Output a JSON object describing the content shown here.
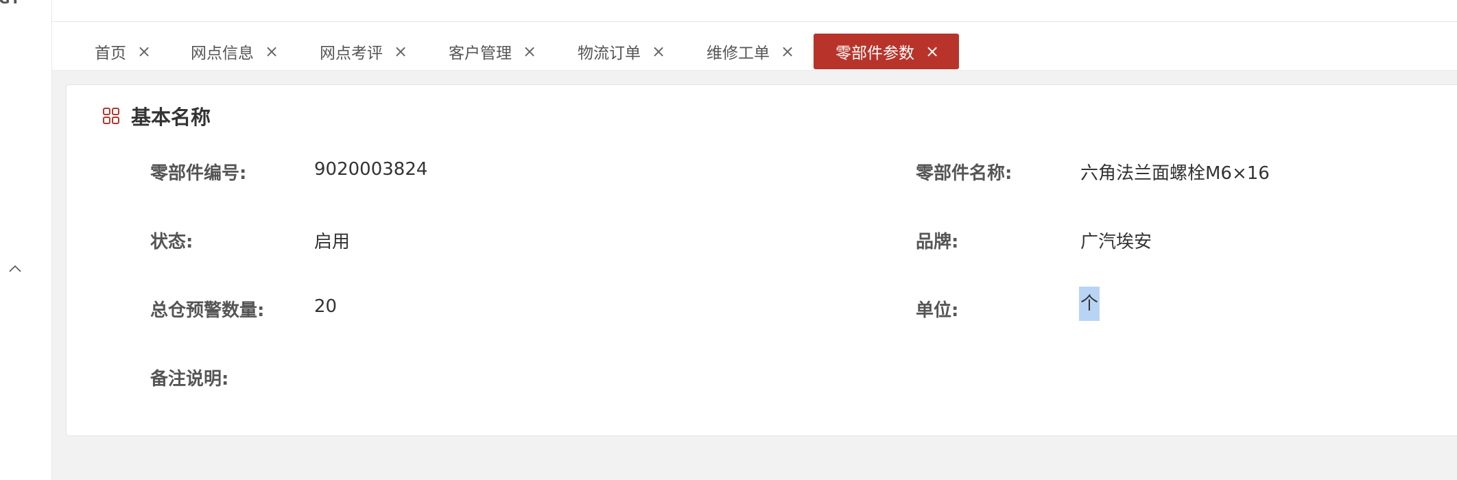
{
  "sidebar": {
    "logo_text": "GY",
    "collapse_icon": "chevron-up-icon"
  },
  "tabs": [
    {
      "label": "首页",
      "active": false
    },
    {
      "label": "网点信息",
      "active": false
    },
    {
      "label": "网点考评",
      "active": false
    },
    {
      "label": "客户管理",
      "active": false
    },
    {
      "label": "物流订单",
      "active": false
    },
    {
      "label": "维修工单",
      "active": false
    },
    {
      "label": "零部件参数",
      "active": true
    }
  ],
  "tab_close_glyph": "×",
  "colors": {
    "accent": "#b8342a",
    "selection": "#b8d4f5",
    "content_bg": "#f2f2f2"
  },
  "section": {
    "icon": "grid-icon",
    "title": "基本名称"
  },
  "fields": {
    "part_number": {
      "label": "零部件编号:",
      "value": "9020003824"
    },
    "part_name": {
      "label": "零部件名称:",
      "value": "六角法兰面螺栓M6×16"
    },
    "status": {
      "label": "状态:",
      "value": "启用"
    },
    "brand": {
      "label": "品牌:",
      "value": "广汽埃安"
    },
    "warning_qty": {
      "label": "总仓预警数量:",
      "value": "20"
    },
    "unit": {
      "label": "单位:",
      "value": "个"
    },
    "remark": {
      "label": "备注说明:",
      "value": ""
    }
  }
}
